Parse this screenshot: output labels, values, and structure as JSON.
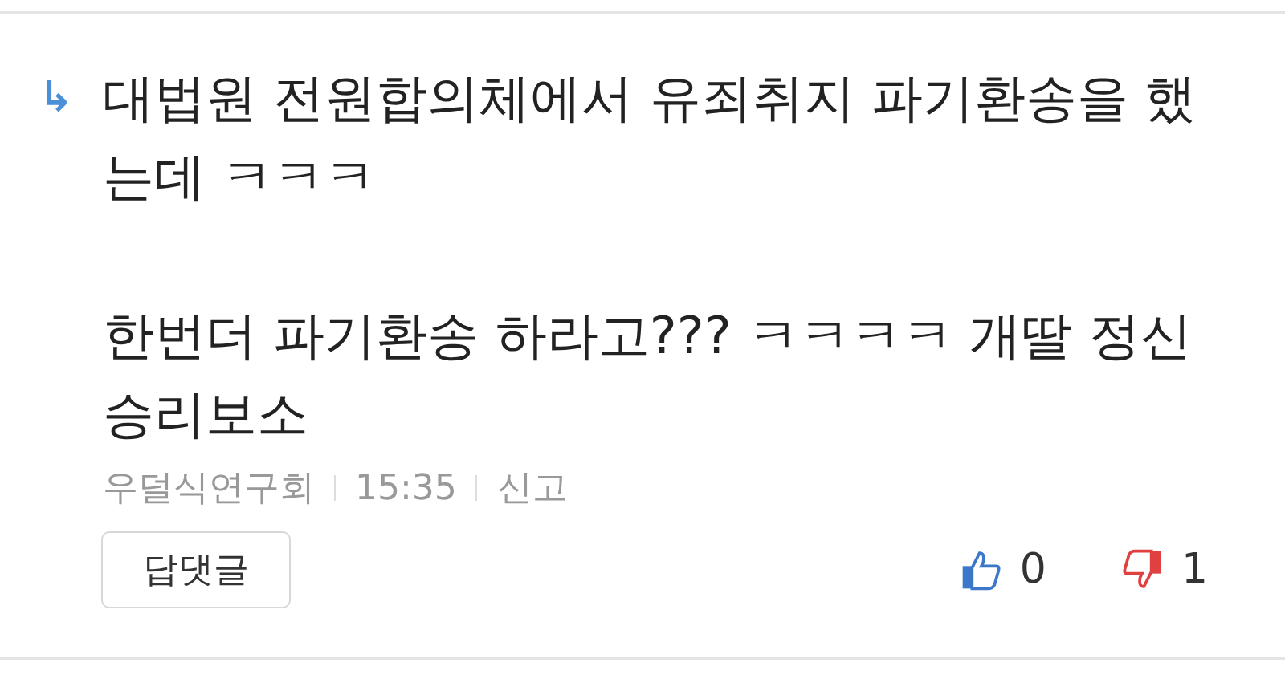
{
  "comment": {
    "reply_icon": "↳",
    "paragraphs": [
      "대법원 전원합의체에서 유죄취지 파기환송을 했는데 ㅋㅋㅋ",
      "한번더 파기환송 하라고??? ㅋㅋㅋㅋ 개딸 정신승리보소"
    ],
    "author": "우덜식연구회",
    "time": "15:35",
    "report": "신고",
    "reply_button": "답댓글",
    "likes": "0",
    "dislikes": "1"
  }
}
